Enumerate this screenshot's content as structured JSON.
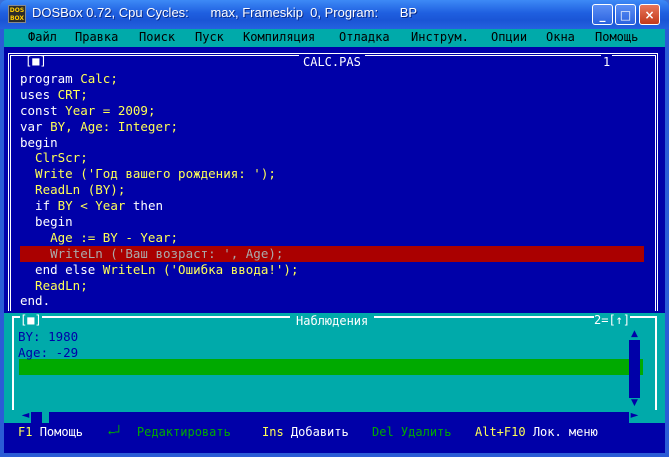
{
  "window": {
    "title": "DOSBox 0.72, Cpu Cycles:      max, Frameskip  0, Program:      BP",
    "icon_label": "DOS BOX",
    "minimize_glyph": "_",
    "maximize_glyph": "□",
    "close_glyph": "×"
  },
  "menu": [
    {
      "label": "Файл"
    },
    {
      "label": "Правка"
    },
    {
      "label": "Поиск"
    },
    {
      "label": "Пуск"
    },
    {
      "label": "Компиляция"
    },
    {
      "label": "Отладка"
    },
    {
      "label": "Инструм."
    },
    {
      "label": "Опции"
    },
    {
      "label": "Окна"
    },
    {
      "label": "Помощь"
    }
  ],
  "editor": {
    "close_box": "[■]",
    "filename": "CALC.PAS",
    "window_number": "1",
    "lines": [
      {
        "text": "program Calc;"
      },
      {
        "text": "uses CRT;"
      },
      {
        "text": "const Year = 2009;"
      },
      {
        "text": "var BY, Age: Integer;"
      },
      {
        "text": "begin"
      },
      {
        "text": "  ClrScr;"
      },
      {
        "text": "  Write ('Год вашего рождения: ');"
      },
      {
        "text": "  ReadLn (BY);"
      },
      {
        "text": "  if BY < Year then"
      },
      {
        "text": "  begin"
      },
      {
        "text": "    Age := BY - Year;"
      },
      {
        "text": "    WriteLn ('Ваш возраст: ', Age);"
      },
      {
        "text": "  end else WriteLn ('Ошибка ввода!');"
      },
      {
        "text": "  ReadLn;"
      },
      {
        "text": "end."
      }
    ],
    "highlighted_line": 11
  },
  "watches": {
    "close_box": "[■]",
    "title": "Наблюдения",
    "right_controls": "2=[↑]",
    "items": [
      "BY: 1980",
      "Age: -29"
    ]
  },
  "status": [
    {
      "key": "F1",
      "desc": "Помощь",
      "enabled": true
    },
    {
      "key": "←┘",
      "desc": "Редактировать",
      "enabled": false
    },
    {
      "key": "Ins",
      "desc": "Добавить",
      "enabled": true
    },
    {
      "key": "Del",
      "desc": "Удалить",
      "enabled": false
    },
    {
      "key": "Alt+F10",
      "desc": "Лок. меню",
      "enabled": true
    }
  ],
  "colors": {
    "dos_blue": "#0000a8",
    "dos_cyan": "#00aaaa",
    "dos_red": "#aa0000",
    "dos_green": "#00aa00",
    "dos_yellow": "#ffff55",
    "xp_title_blue": "#1f5fe0"
  }
}
